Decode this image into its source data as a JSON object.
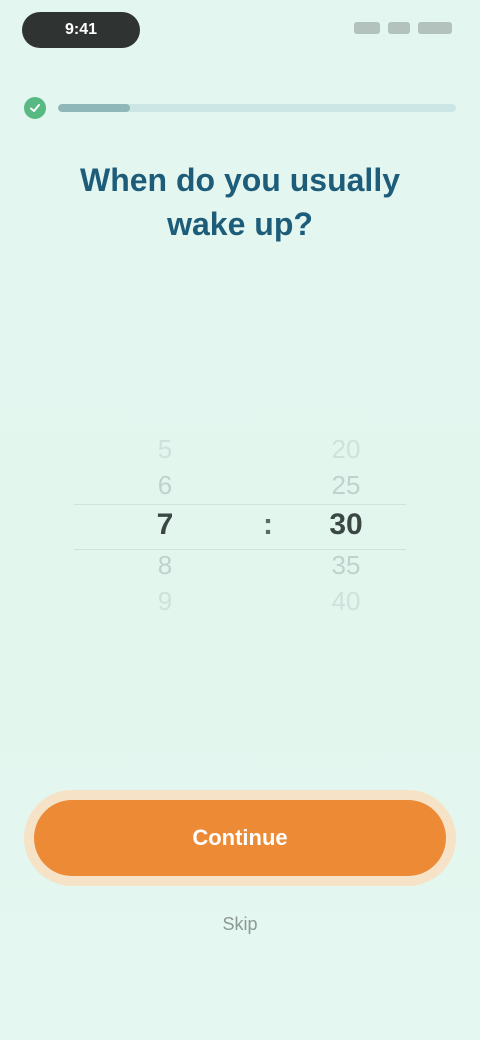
{
  "status_bar": {
    "time": "9:41",
    "icons": [
      "signal-icon",
      "wifi-icon",
      "battery-icon"
    ]
  },
  "progress": {
    "fraction": 0.18,
    "icon": "check-icon",
    "color": "#59b982"
  },
  "question": {
    "title": "When do you usually wake up?"
  },
  "picker": {
    "hours": [
      "5",
      "6",
      "7",
      "8",
      "9"
    ],
    "minutes": [
      "20",
      "25",
      "30",
      "35",
      "40"
    ],
    "separator": ":",
    "selected_hour": "7",
    "selected_minute": "30"
  },
  "actions": {
    "continue_label": "Continue",
    "skip_label": "Skip"
  },
  "colors": {
    "background": "#e3f6ef",
    "title": "#1e5d7a",
    "accent": "#ec8a36"
  }
}
